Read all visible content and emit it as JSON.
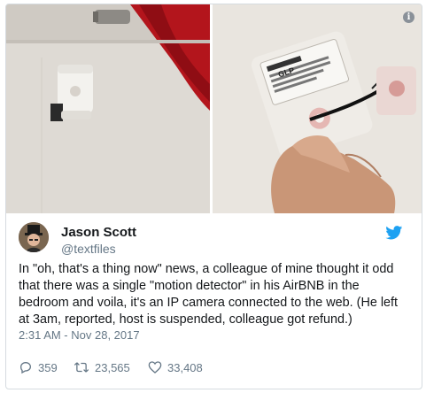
{
  "tweet": {
    "author_name": "Jason Scott",
    "author_handle": "@textfiles",
    "text": "In \"oh, that's a thing now\" news, a colleague of mine thought it odd that there was a single \"motion detector\" in his AirBNB in the bedroom and voila, it's an IP camera connected to the web. (He left at 3am, reported, host is suspended, colleague got refund.)",
    "timestamp": "2:31 AM - Nov 28, 2017",
    "replies": "359",
    "retweets": "23,565",
    "likes": "33,408"
  },
  "photos": {
    "right_label_brand": "GLP"
  },
  "colors": {
    "twitter_blue": "#1da1f2",
    "text": "#14171a",
    "muted": "#657786"
  },
  "icons": [
    "info-icon",
    "twitter-bird-icon",
    "reply-icon",
    "retweet-icon",
    "like-icon"
  ]
}
